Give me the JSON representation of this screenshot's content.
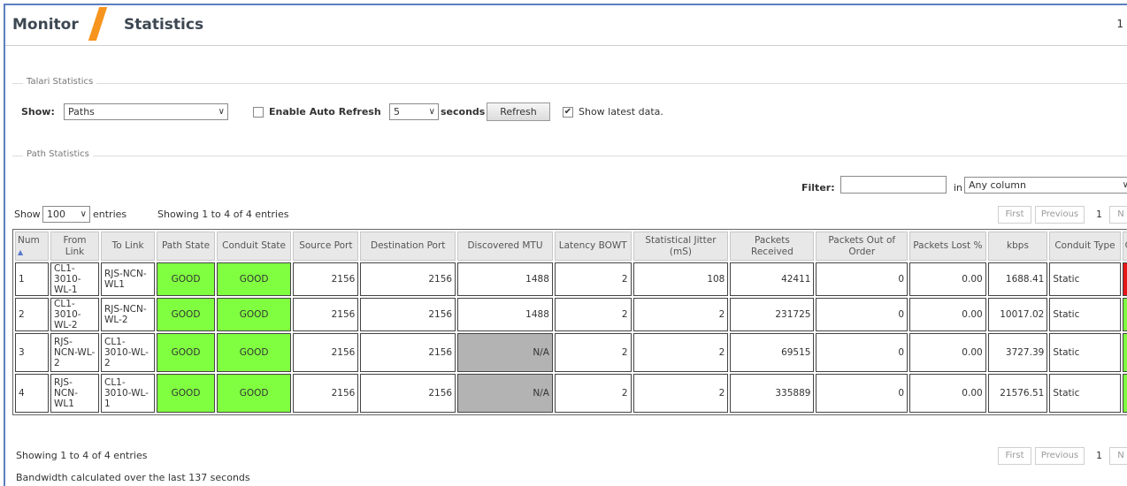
{
  "header": {
    "section": "Monitor",
    "page": "Statistics",
    "corner_number": "1"
  },
  "talari": {
    "legend": "Talari Statistics",
    "show_label": "Show:",
    "show_value": "Paths",
    "auto_refresh_label": "Enable Auto Refresh",
    "auto_refresh_checked": false,
    "interval_value": "5",
    "seconds_label": "seconds",
    "refresh_label": "Refresh",
    "latest_label": "Show latest data.",
    "latest_checked": true
  },
  "path_stats": {
    "legend": "Path Statistics",
    "filter_label": "Filter:",
    "filter_value": "",
    "in_label": "in",
    "column_value": "Any column",
    "show_label": "Show",
    "entries_value": "100",
    "entries_label": "entries",
    "showing_top": "Showing 1 to 4 of 4 entries",
    "showing_bottom": "Showing 1 to 4 of 4 entries",
    "bandwidth_note": "Bandwidth calculated over the last 137 seconds",
    "pager": {
      "first": "First",
      "previous": "Previous",
      "page": "1",
      "next": "N"
    }
  },
  "table": {
    "headers": [
      "Num",
      "From Link",
      "To Link",
      "Path State",
      "Conduit State",
      "Source Port",
      "Destination Port",
      "Discovered MTU",
      "Latency BOWT",
      "Statistical Jitter (mS)",
      "Packets Received",
      "Packets Out of Order",
      "Packets Lost %",
      "kbps",
      "Conduit Type",
      "Co"
    ],
    "rows": [
      {
        "num": "1",
        "from": "CL1-3010-WL-1",
        "to": "RJS-NCN-WL1",
        "path_state": "GOOD",
        "conduit_state": "GOOD",
        "src_port": "2156",
        "dst_port": "2156",
        "mtu": "1488",
        "latency": "2",
        "jitter": "108",
        "received": "42411",
        "out_of_order": "0",
        "lost": "0.00",
        "kbps": "1688.41",
        "type": "Static",
        "last_color": "#e81717"
      },
      {
        "num": "2",
        "from": "CL1-3010-WL-2",
        "to": "RJS-NCN-WL-2",
        "path_state": "GOOD",
        "conduit_state": "GOOD",
        "src_port": "2156",
        "dst_port": "2156",
        "mtu": "1488",
        "latency": "2",
        "jitter": "2",
        "received": "231725",
        "out_of_order": "0",
        "lost": "0.00",
        "kbps": "10017.02",
        "type": "Static",
        "last_color": "#80ff40"
      },
      {
        "num": "3",
        "from": "RJS-NCN-WL-2",
        "to": "CL1-3010-WL-2",
        "path_state": "GOOD",
        "conduit_state": "GOOD",
        "src_port": "2156",
        "dst_port": "2156",
        "mtu": "N/A",
        "latency": "2",
        "jitter": "2",
        "received": "69515",
        "out_of_order": "0",
        "lost": "0.00",
        "kbps": "3727.39",
        "type": "Static",
        "last_color": "#80ff40"
      },
      {
        "num": "4",
        "from": "RJS-NCN-WL1",
        "to": "CL1-3010-WL-1",
        "path_state": "GOOD",
        "conduit_state": "GOOD",
        "src_port": "2156",
        "dst_port": "2156",
        "mtu": "N/A",
        "latency": "2",
        "jitter": "2",
        "received": "335889",
        "out_of_order": "0",
        "lost": "0.00",
        "kbps": "21576.51",
        "type": "Static",
        "last_color": "#80ff40"
      }
    ]
  },
  "colors": {
    "accent_slash": "#f7941d",
    "good": "#80ff40",
    "na": "#b3b3b3",
    "bad": "#e81717",
    "frame": "#5b7fc0"
  },
  "icons": {
    "sort": "sort-ascending-icon",
    "dropdown": "chevron-down-icon",
    "check": "checkmark-icon"
  }
}
